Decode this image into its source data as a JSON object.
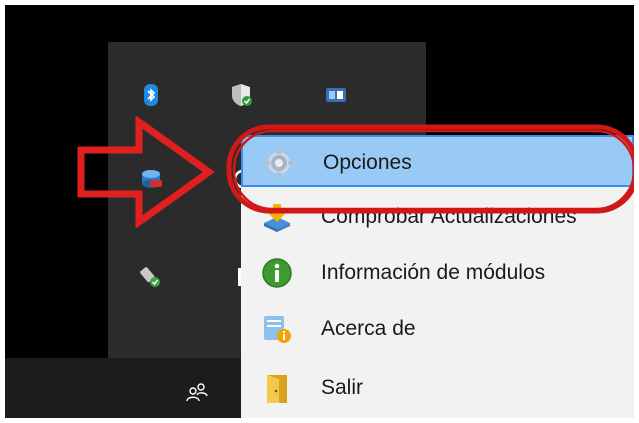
{
  "context_menu": {
    "items": [
      {
        "label": "Opciones",
        "icon": "gear-icon",
        "highlighted": true
      },
      {
        "label": "Comprobar Actualizaciones",
        "icon": "download-icon",
        "highlighted": false
      },
      {
        "label": "Información de módulos",
        "icon": "info-icon",
        "highlighted": false
      },
      {
        "label": "Acerca de",
        "icon": "about-icon",
        "highlighted": false
      },
      {
        "label": "Salir",
        "icon": "exit-door-icon",
        "highlighted": false
      }
    ]
  },
  "tray": {
    "icons": [
      "bluetooth-icon",
      "windows-security-icon",
      "network-app-icon",
      "database-app-icon",
      "usb-drive-icon"
    ]
  },
  "annotations": {
    "arrow_color": "#e02020",
    "oval_color": "#d01818"
  },
  "colors": {
    "highlight": "#99c9f5",
    "highlight_border": "#3a8ee6",
    "menu_bg": "#f2f2f2",
    "flyout_bg": "#2b2b2b",
    "taskbar_bg": "#1c1c1c"
  }
}
